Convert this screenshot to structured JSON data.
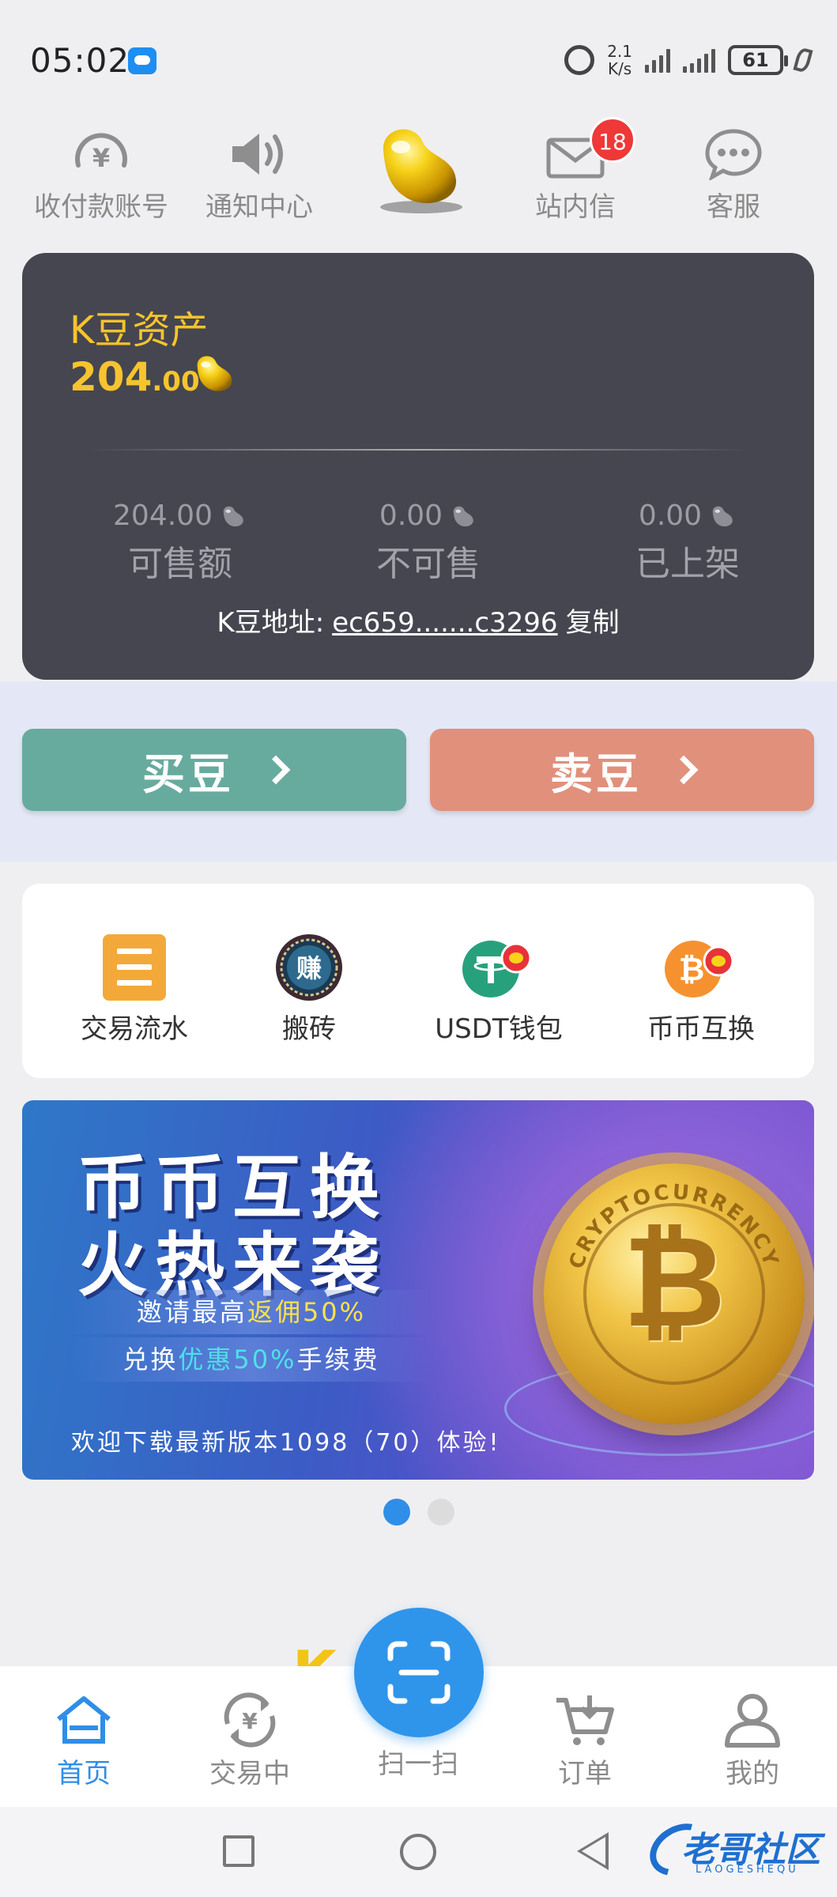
{
  "status_bar": {
    "time": "05:02",
    "net_speed_value": "2.1",
    "net_speed_unit": "K/s",
    "battery": "61",
    "icons": [
      "chat-bubble-icon",
      "alarm-icon",
      "signal-icon",
      "battery-icon",
      "leaf-icon"
    ]
  },
  "top_nav": {
    "items": [
      {
        "label": "收付款账号",
        "icon": "yen-coin-icon"
      },
      {
        "label": "通知中心",
        "icon": "speaker-icon"
      },
      {
        "label": "",
        "icon": "golden-bean-icon"
      },
      {
        "label": "站内信",
        "icon": "envelope-icon",
        "badge": "18"
      },
      {
        "label": "客服",
        "icon": "chat-icon"
      }
    ]
  },
  "asset": {
    "title": "K豆资产",
    "amount_int": "204",
    "amount_dec": ".00",
    "stats": [
      {
        "value": "204.00",
        "label": "可售额"
      },
      {
        "value": "0.00",
        "label": "不可售"
      },
      {
        "value": "0.00",
        "label": "已上架"
      }
    ],
    "address_label": "K豆地址:",
    "address": "ec659.......c3296",
    "copy_label": "复制"
  },
  "actions": {
    "buy_label": "买豆",
    "sell_label": "卖豆"
  },
  "menu": {
    "items": [
      {
        "label": "交易流水",
        "icon": "ledger-icon"
      },
      {
        "label": "搬砖",
        "icon": "earn-badge-icon",
        "glyph": "赚"
      },
      {
        "label": "USDT钱包",
        "icon": "tether-icon"
      },
      {
        "label": "币币互换",
        "icon": "bitcoin-icon"
      }
    ]
  },
  "banner": {
    "line1": "币币互换",
    "line2": "火热来袭",
    "promo1_prefix": "邀请最高",
    "promo1_highlight": "返佣50%",
    "promo2_prefix": "兑换",
    "promo2_highlight": "优惠50%",
    "promo2_suffix": "手续费",
    "footer": "欢迎下载最新版本1098（70）体验!",
    "coin_text": "CRYPTOCURRENCY",
    "coin_glyph": "₿",
    "page_count": 2,
    "active_page": 1
  },
  "tabbar": {
    "items": [
      {
        "label": "首页",
        "icon": "home-icon",
        "active": true
      },
      {
        "label": "交易中",
        "icon": "exchange-icon",
        "active": false
      },
      {
        "label": "扫一扫",
        "icon": "scan-icon",
        "active": false
      },
      {
        "label": "订单",
        "icon": "cart-icon",
        "active": false
      },
      {
        "label": "我的",
        "icon": "user-icon",
        "active": false
      }
    ]
  },
  "watermark": {
    "text": "老哥社区",
    "sub": "LAOGESHEQU"
  },
  "colors": {
    "accent_blue": "#2f8ee8",
    "gold": "#f6c42e",
    "card_dark": "#464650",
    "buy_green": "#67ab9e",
    "sell_red": "#e1907c",
    "badge_red": "#ef3838"
  }
}
